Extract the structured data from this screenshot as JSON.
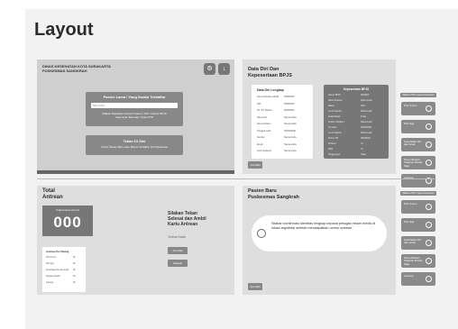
{
  "page": {
    "title": "Layout"
  },
  "screen_home": {
    "agency_line1": "DINAS KESEHATAN KOTA SURAKARTA",
    "agency_line2": "PUSKESMAS SANGKRAH",
    "box_a": {
      "title": "Pasien Lama / Yang Sudah Terdaftar",
      "placeholder": "NIK Anda...",
      "subtext1": "Silakan Masukkan Nomor Pasien / NIK / Nomor BPJS",
      "subtext2": "Atau Scan Barcode / Scan KTP"
    },
    "box_b": {
      "title": "Tekan Di Sini",
      "subtext": "Untuk Pasien Baru Atau Belum Terdaftar Di Puskesmas"
    },
    "icons": [
      "gear-icon",
      "download-icon"
    ]
  },
  "screen_bpjs": {
    "title_line1": "Data Diri Dan",
    "title_line2": "Kepesertaan BPJS",
    "card_title": "Data Diri Lengkap",
    "card_rows": [
      {
        "k": "Nomor Rekam Medik",
        "v": "00000000"
      },
      {
        "k": "NIK",
        "v": "00000000"
      },
      {
        "k": "No. KK Pasien",
        "v": "00000000"
      },
      {
        "k": "Nama KK",
        "v": "Nama Anda"
      },
      {
        "k": "Nama Pasien",
        "v": "Nama Anda"
      },
      {
        "k": "Tanggal Lahir",
        "v": "00/00/0000"
      },
      {
        "k": "Gender",
        "v": "Nama Anda"
      },
      {
        "k": "Email",
        "v": "Nama Anda"
      },
      {
        "k": "Jenis Kelamin",
        "v": "Nama Anda"
      }
    ],
    "dark_title": "Kepesertaan BPJS",
    "dark_rows": [
      {
        "k": "Nomor BPJS",
        "v": "0000000"
      },
      {
        "k": "Nama Peserta",
        "v": "Nama Anda"
      },
      {
        "k": "Status",
        "v": "Aktif"
      },
      {
        "k": "Jenis Peserta",
        "v": "Nama Anda"
      },
      {
        "k": "Kelas Rawat",
        "v": "Kelas"
      },
      {
        "k": "Faskes Tingkat 1",
        "v": "Nama Anda"
      },
      {
        "k": "Tgl Lahir",
        "v": "00/00/0000"
      },
      {
        "k": "Jenis Kelamin",
        "v": "Nama Anda"
      },
      {
        "k": "Nomor HP",
        "v": "00000000"
      },
      {
        "k": "Prolanis",
        "v": "Ya"
      },
      {
        "k": "PRB",
        "v": "Ya"
      },
      {
        "k": "Tanggungan",
        "v": "Tidak"
      }
    ],
    "back_label": "Kembali"
  },
  "sidebar_top": {
    "header": "Silakan Pilih Tujuan Pelayanan Anda",
    "items": [
      {
        "label": "Poli Umum",
        "icon": "stethoscope-icon"
      },
      {
        "label": "Poli Gigi",
        "icon": "tooth-icon"
      },
      {
        "label": "Kesehatan Ibu dan Anak",
        "icon": "mother-child-icon"
      },
      {
        "label": "Pemeriksaan Tekanan Darah Saja",
        "icon": "heart-icon"
      },
      {
        "label": "Lainnya",
        "icon": "dots-icon"
      }
    ]
  },
  "screen_queue": {
    "title_line1": "Total",
    "title_line2": "Antrean",
    "queue_label": "Total Antrean Hari Ini",
    "queue_number": "000",
    "table_title": "Antrean Per Ruang",
    "table_rows": [
      {
        "k": "Poli Umum",
        "v": "00"
      },
      {
        "k": "Poli Gigi",
        "v": "00"
      },
      {
        "k": "Kesehatan Ibu dan Anak",
        "v": "00"
      },
      {
        "k": "Tekanan Darah",
        "v": "00"
      },
      {
        "k": "Lainnya",
        "v": "00"
      }
    ],
    "instruction_line1": "Silakan Tekan",
    "instruction_line2": "Selesai dan Ambil",
    "instruction_line3": "Kartu Antrean",
    "thanks": "Terima Kasih",
    "button_1": "Kembali",
    "button_2": "Selesai"
  },
  "screen_new_patient": {
    "title_line1": "Pasien Baru",
    "title_line2": "Puskesmas Sangkrah",
    "message": "Silakan konfirmasi identitas lengkap kepada petugas rekam medis di lokasi registrasi setelah mendapatkan nomor antrean",
    "back_label": "Kembali"
  },
  "sidebar_bottom": {
    "header": "Silakan Pilih Tujuan Pelayanan Anda",
    "items": [
      {
        "label": "Poli Umum",
        "icon": "stethoscope-icon"
      },
      {
        "label": "Poli Gigi",
        "icon": "tooth-icon"
      },
      {
        "label": "Kesehatan Ibu dan Anak",
        "icon": "mother-child-icon"
      },
      {
        "label": "Pemeriksaan Tekanan Darah Saja",
        "icon": "heart-icon"
      },
      {
        "label": "Lainnya",
        "icon": "dots-icon"
      }
    ]
  }
}
